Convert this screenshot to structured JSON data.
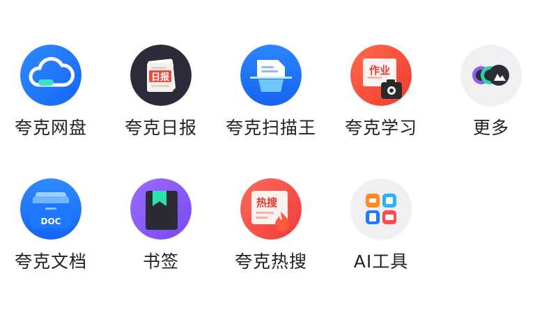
{
  "apps": [
    {
      "label": "夸克网盘",
      "icon": "cloud-drive-icon"
    },
    {
      "label": "夸克日报",
      "icon": "newspaper-icon",
      "badge": "日报"
    },
    {
      "label": "夸克扫描王",
      "icon": "scanner-icon"
    },
    {
      "label": "夸克学习",
      "icon": "homework-camera-icon",
      "badge": "作业"
    },
    {
      "label": "更多",
      "icon": "more-apps-icon"
    },
    {
      "label": "夸克文档",
      "icon": "document-folder-icon",
      "badge": "DOC"
    },
    {
      "label": "书签",
      "icon": "bookmark-icon"
    },
    {
      "label": "夸克热搜",
      "icon": "hot-search-icon",
      "badge": "热搜"
    },
    {
      "label": "AI工具",
      "icon": "ai-tools-icon"
    }
  ],
  "colors": {
    "text": "#1f1f1f",
    "blue": "#1677ff",
    "red": "#f04a3e",
    "purple": "#8b5cf6",
    "dark": "#2d2d3a"
  }
}
